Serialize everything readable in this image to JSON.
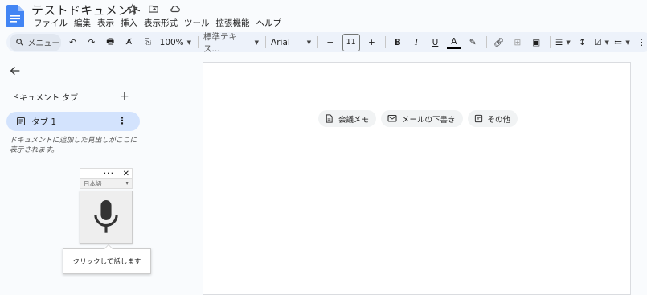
{
  "title": "テストドキュメント",
  "menu": [
    "ファイル",
    "編集",
    "表示",
    "挿入",
    "表示形式",
    "ツール",
    "拡張機能",
    "ヘルプ"
  ],
  "toolbar": {
    "search_placeholder": "メニュー",
    "zoom": "100%",
    "style": "標準テキス...",
    "font": "Arial",
    "font_size": "11"
  },
  "sidebar": {
    "heading": "ドキュメント タブ",
    "tab_label": "タブ 1",
    "hint": "ドキュメントに追加した見出しがここに表示されます。"
  },
  "voice": {
    "lang": "日本語",
    "tooltip": "クリックして話します"
  },
  "chips": [
    "会議メモ",
    "メールの下書き",
    "その他"
  ],
  "colors": {
    "accent": "#d3e3fd",
    "toolbar_bg": "#edf2fa",
    "doc_blue": "#4285f4"
  }
}
